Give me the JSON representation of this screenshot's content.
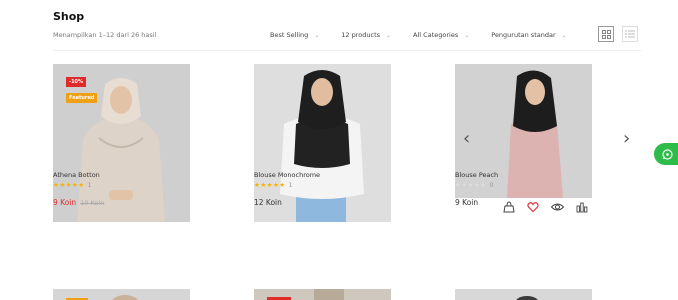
{
  "header": {
    "title": "Shop",
    "result_count": "Menampilkan 1–12 dari 26 hasil"
  },
  "toolbar": {
    "sort": "Best Selling",
    "per_page": "12 products",
    "category": "All Categories",
    "order": "Pengurutan standar",
    "chevron": "⌄"
  },
  "products": [
    {
      "title": "Athena Botton",
      "badges": [
        "-10%",
        "Featured"
      ],
      "stars": "★★★★★",
      "rating_count": "1",
      "price": "9 Koin",
      "old_price": "10 Koin"
    },
    {
      "title": "Blouse Monochrome",
      "stars": "★★★★★",
      "rating_count": "1",
      "price": "12 Koin"
    },
    {
      "title": "Blouse Peach",
      "stars": "★★★★★",
      "rating_count": "0",
      "price": "9 Koin"
    }
  ],
  "icons": {
    "grid_view": "grid-icon",
    "list_view": "list-icon",
    "prev": "chevron-left-icon",
    "next": "chevron-right-icon",
    "cart": "shopping-bag-icon",
    "wishlist": "heart-icon",
    "quick_view": "eye-icon",
    "compare": "bar-chart-icon",
    "whatsapp": "whatsapp-icon"
  },
  "arrows": {
    "prev": "‹",
    "next": "›"
  },
  "colors": {
    "sale_red": "#e02b2b",
    "featured_orange": "#f0a017",
    "star_gold": "#f5b301",
    "whatsapp_green": "#2dbb4a"
  }
}
